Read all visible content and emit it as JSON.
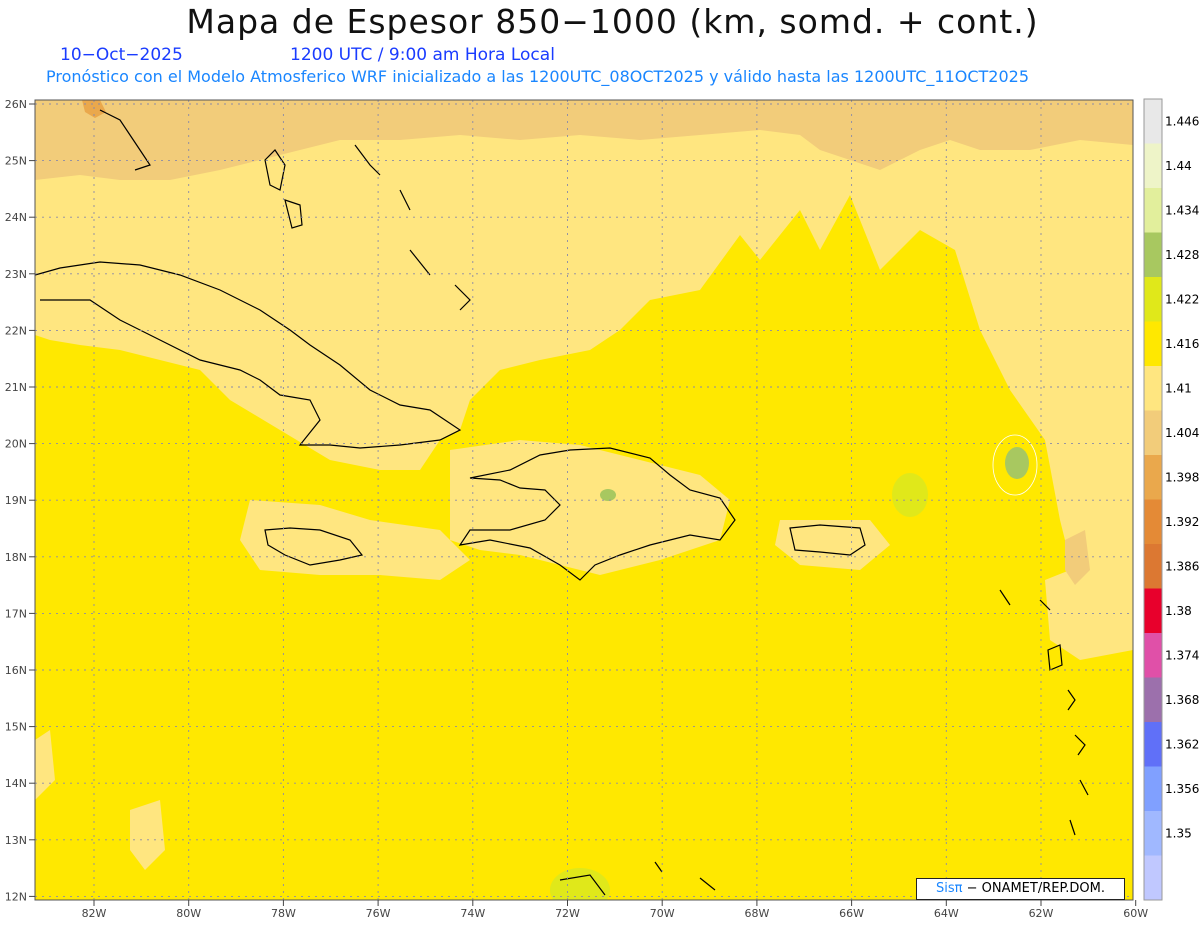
{
  "header": {
    "title": "Mapa de Espesor 850−1000 (km, somd. + cont.)",
    "date": "10−Oct−2025",
    "time": "1200 UTC / 9:00 am Hora Local",
    "subtitle": "Pronóstico con el Modelo Atmosferico WRF inicializado a las 1200UTC_08OCT2025 y válido hasta las  1200UTC_11OCT2025"
  },
  "map": {
    "lat_labels": [
      "26N",
      "25N",
      "24N",
      "23N",
      "22N",
      "21N",
      "20N",
      "19N",
      "18N",
      "17N",
      "16N",
      "15N",
      "14N",
      "13N",
      "12N"
    ],
    "lon_labels": [
      "82W",
      "80W",
      "78W",
      "76W",
      "74W",
      "72W",
      "70W",
      "68W",
      "66W",
      "64W",
      "62W",
      "60W"
    ]
  },
  "colorbar": {
    "labels": [
      "1.446",
      "1.44",
      "1.434",
      "1.428",
      "1.422",
      "1.416",
      "1.41",
      "1.404",
      "1.398",
      "1.392",
      "1.386",
      "1.38",
      "1.374",
      "1.368",
      "1.362",
      "1.356",
      "1.35"
    ],
    "colors": [
      "#e8e8e8",
      "#eef4c8",
      "#e2ef9c",
      "#a8c860",
      "#e0e81a",
      "#ffe800",
      "#ffe680",
      "#f2cc7a",
      "#eaa84c",
      "#e48a36",
      "#dc7832",
      "#e8002c",
      "#e050a8",
      "#9c70ac",
      "#6070f8",
      "#80a0ff",
      "#a0b8ff",
      "#c0c8ff"
    ]
  },
  "credit": {
    "sis": "Sisπ",
    "rest": " − ONAMET/REP.DOM."
  }
}
